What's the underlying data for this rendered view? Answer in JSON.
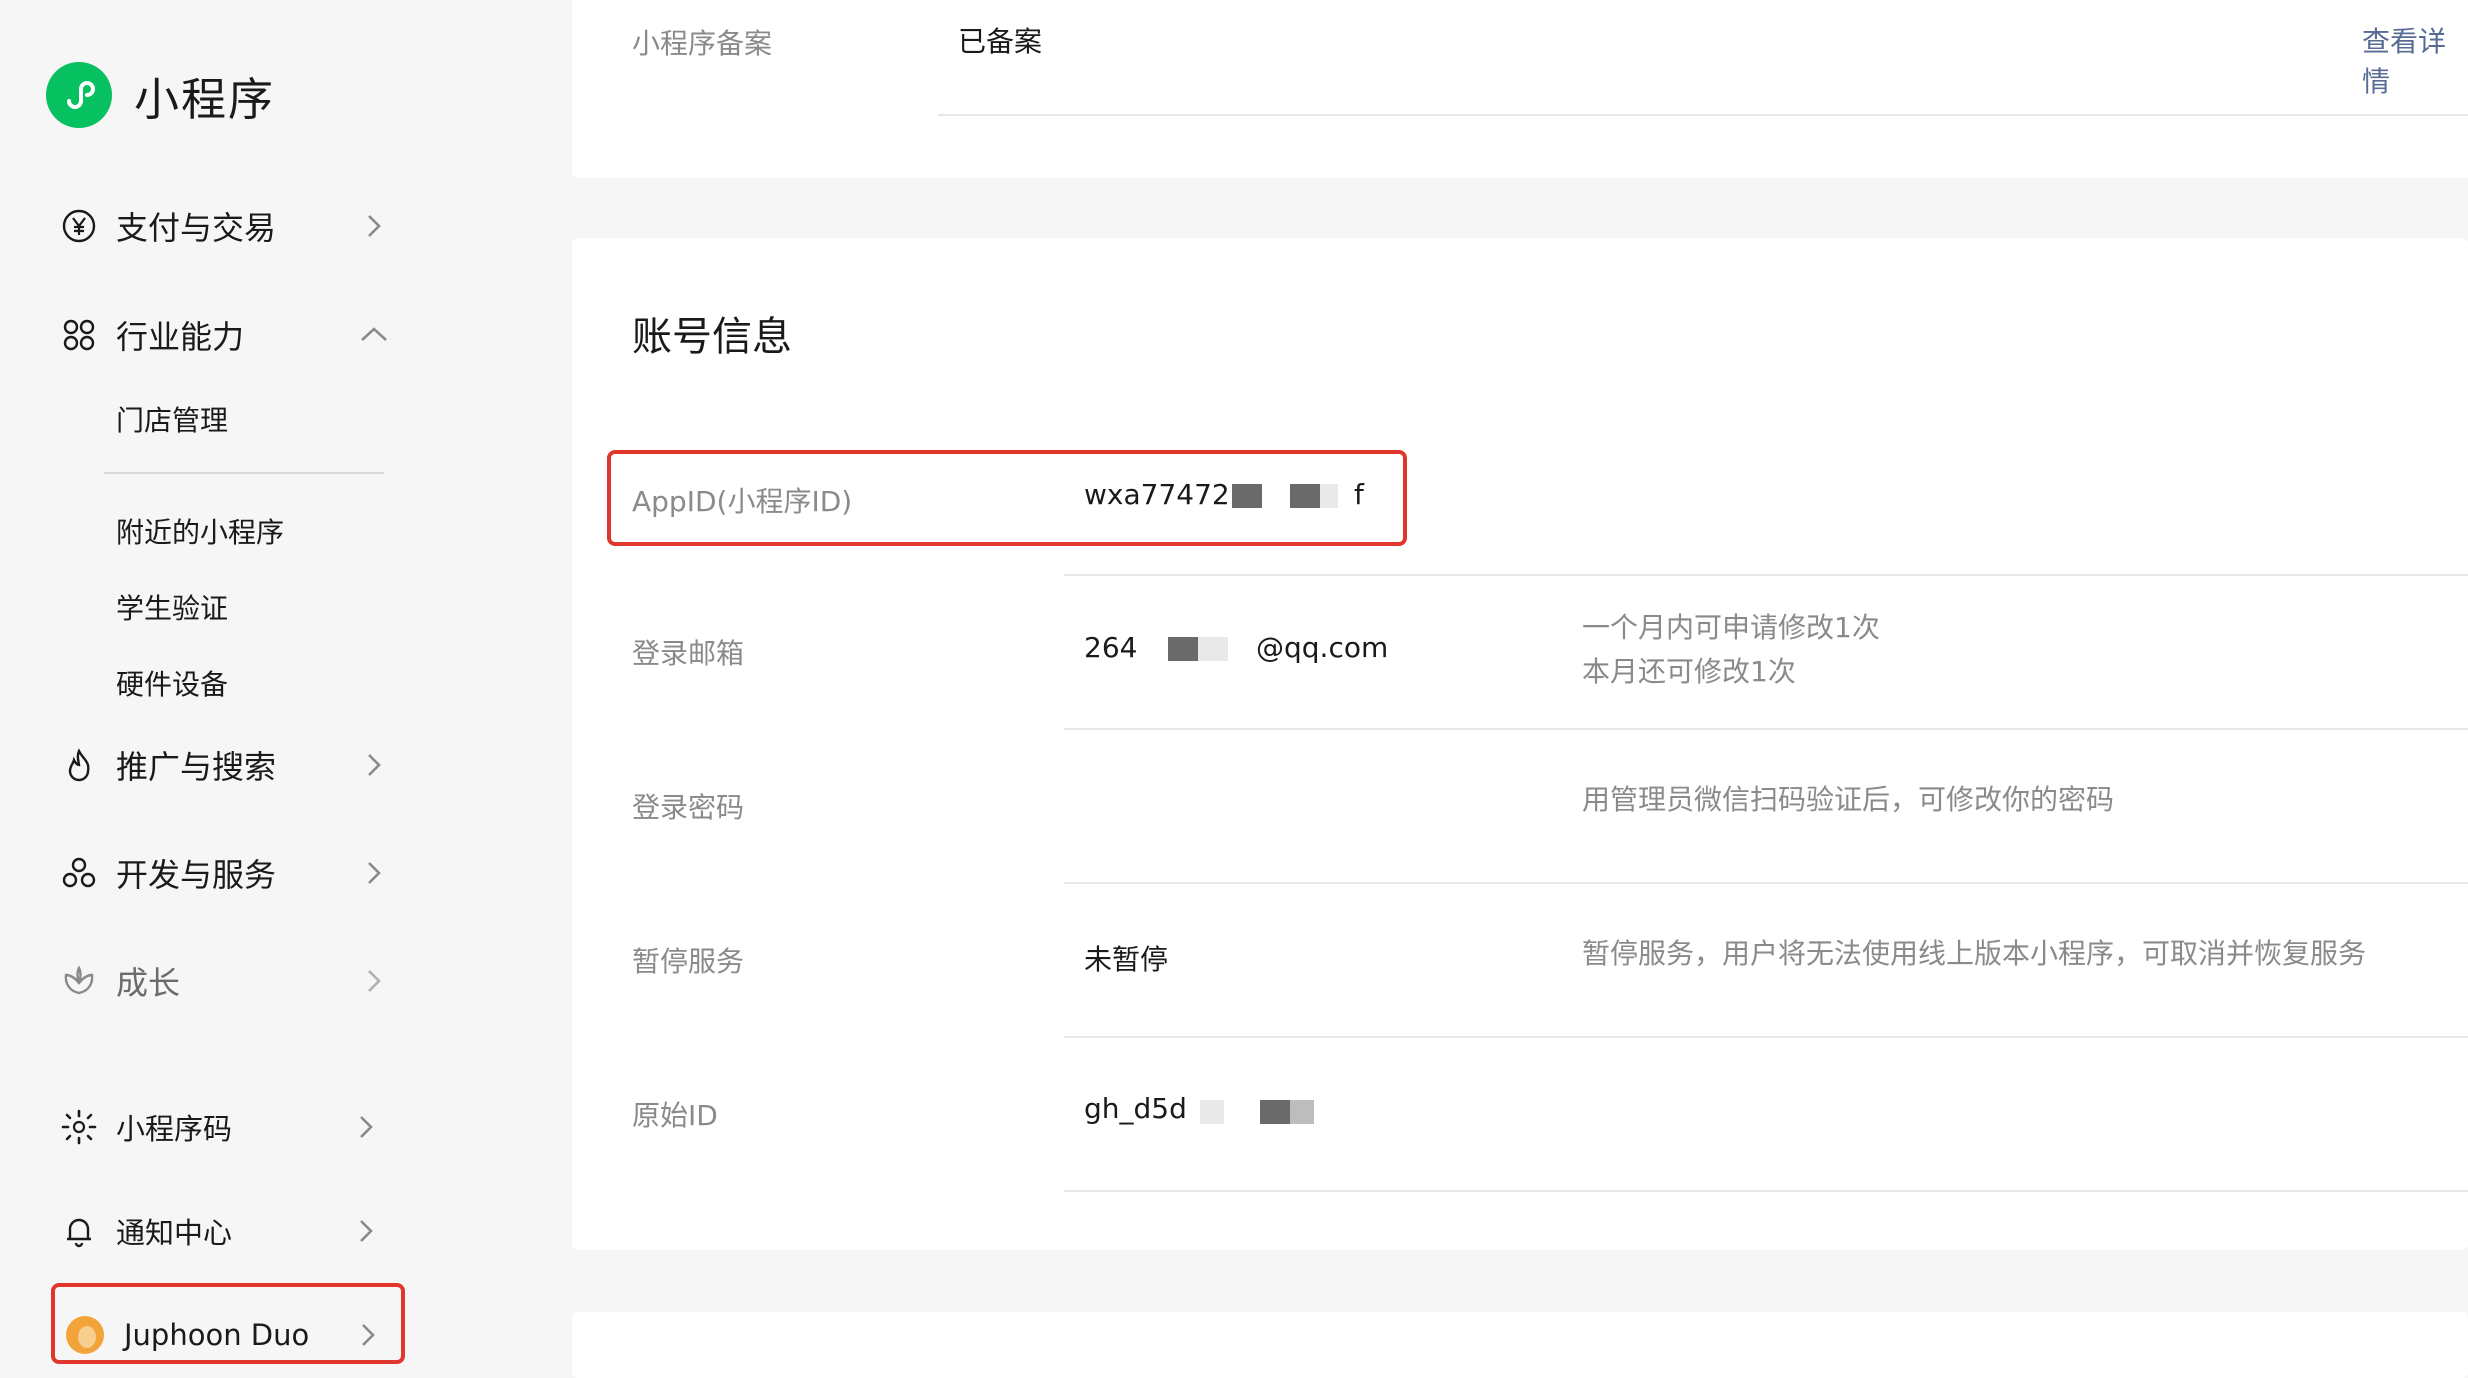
{
  "sidebar": {
    "app_title": "小程序",
    "icons": {
      "logo": "mini-program-logo",
      "payment": "yuan-circle-icon",
      "industry": "nodes-icon",
      "promotion": "flame-icon",
      "dev": "cluster-icon",
      "growth": "flower-icon",
      "code": "sun-code-icon",
      "notify": "bell-icon",
      "chevron": "chevron-right-icon"
    },
    "items": {
      "payment": "支付与交易",
      "industry": "行业能力",
      "promotion": "推广与搜索",
      "dev": "开发与服务",
      "growth": "成长",
      "code": "小程序码",
      "notify": "通知中心",
      "account": "Juphoon Duo"
    },
    "industry_sub": [
      "门店管理",
      "附近的小程序",
      "学生验证",
      "硬件设备"
    ]
  },
  "record": {
    "label": "小程序备案",
    "value": "已备案",
    "link": "查看详情"
  },
  "account_info": {
    "title": "账号信息",
    "appid": {
      "label": "AppID(小程序ID)",
      "value_prefix": "wxa77472",
      "value_suffix": "f"
    },
    "email": {
      "label": "登录邮箱",
      "value_prefix": "264",
      "value_suffix": "@qq.com",
      "hint_line1": "一个月内可申请修改1次",
      "hint_line2": "本月还可修改1次"
    },
    "password": {
      "label": "登录密码",
      "hint": "用管理员微信扫码验证后，可修改你的密码"
    },
    "pause": {
      "label": "暂停服务",
      "value": "未暂停",
      "hint": "暂停服务，用户将无法使用线上版本小程序，可取消并恢复服务"
    },
    "original_id": {
      "label": "原始ID",
      "value_prefix": "gh_d5d"
    }
  },
  "colors": {
    "accent_green": "#07c160",
    "highlight_red": "#e0362c",
    "link_blue": "#576b95"
  }
}
